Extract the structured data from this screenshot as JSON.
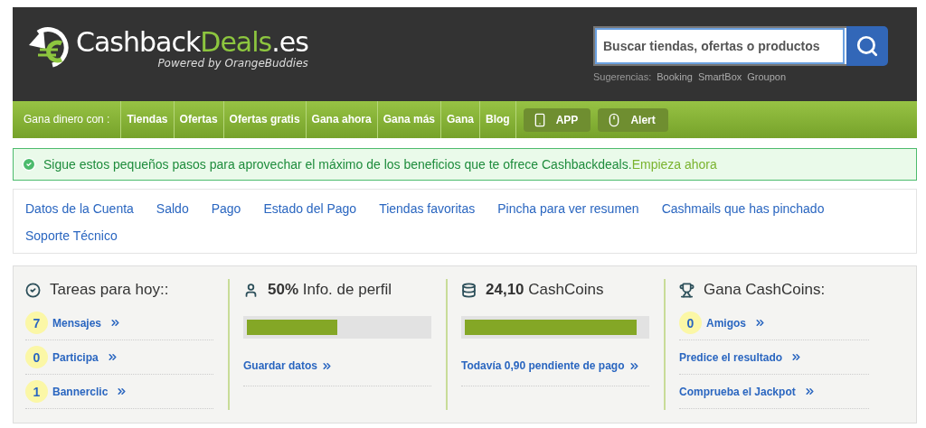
{
  "header": {
    "logo": {
      "name_start": "Cashback",
      "name_highlight": "Deals",
      "name_end": ".es",
      "tagline": "Powered by OrangeBuddies"
    },
    "search": {
      "placeholder": "Buscar tiendas, ofertas o productos",
      "suggestions_label": "Sugerencias:",
      "suggestions": [
        "Booking",
        "SmartBox",
        "Groupon"
      ]
    }
  },
  "nav": {
    "label": "Gana dinero con :",
    "items": [
      "Tiendas",
      "Ofertas",
      "Ofertas gratis",
      "Gana ahora",
      "Gana más",
      "Gana",
      "Blog"
    ],
    "buttons": [
      {
        "kind": "phone",
        "label": "APP"
      },
      {
        "kind": "mouse",
        "label": "Alert"
      }
    ]
  },
  "alert": {
    "message": "Sigue estos pequeños pasos para aprovechar el máximo de los beneficios que te ofrece Cashbackdeals.",
    "link": "Empieza ahora"
  },
  "account_links": [
    "Datos de la Cuenta",
    "Saldo",
    "Pago",
    "Estado del Pago",
    "Tiendas favoritas",
    "Pincha para ver resumen",
    "Cashmails que has pinchado",
    "Soporte Técnico"
  ],
  "stats": [
    {
      "kind": "tasks",
      "title": "Tareas para hoy::",
      "items": [
        {
          "count": "7",
          "label": "Mensajes"
        },
        {
          "count": "0",
          "label": "Participa"
        },
        {
          "count": "1",
          "label": "Bannerclic"
        }
      ]
    },
    {
      "kind": "progress",
      "title": "**50%** Info. de perfil",
      "level": 0.5,
      "link": "Guardar datos"
    },
    {
      "kind": "progress",
      "title": "**24,10** CashCoins",
      "level": 0.95,
      "link": "Todavía 0,90 pendiente de pago"
    },
    {
      "kind": "tasks",
      "title": "Gana CashCoins:",
      "items": [
        {
          "count": "0",
          "label": "Amigos"
        },
        {
          "label": "Predice el resultado"
        },
        {
          "label": "Comprueba el Jackpot"
        }
      ]
    }
  ]
}
